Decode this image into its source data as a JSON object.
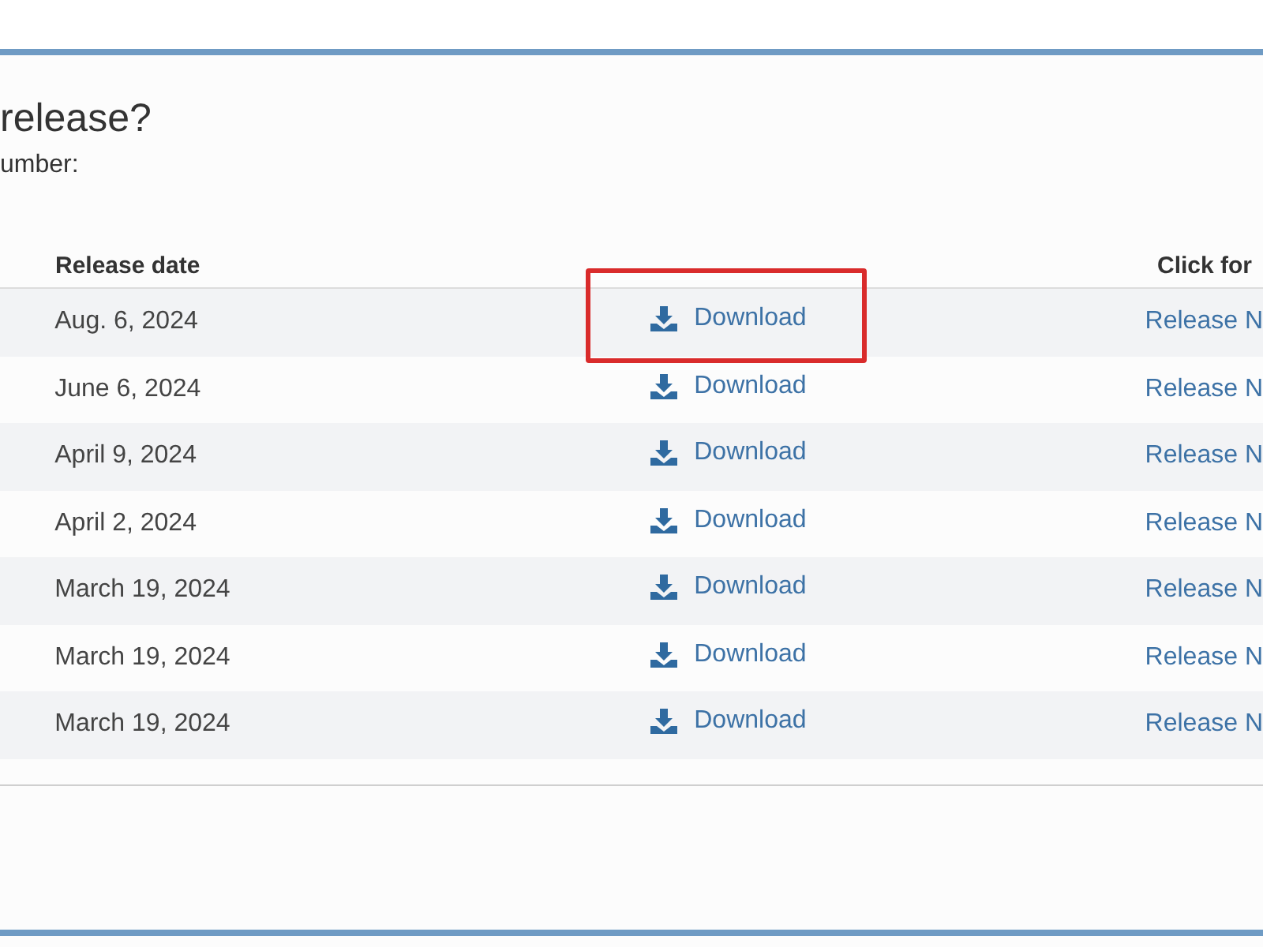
{
  "heading": "release?",
  "prompt": "umber:",
  "table": {
    "columns": [
      "Release date",
      "",
      "Click for"
    ],
    "rows": [
      {
        "date": "Aug. 6, 2024",
        "download": "Download",
        "notes": "Release N",
        "highlighted": true
      },
      {
        "date": "June 6, 2024",
        "download": "Download",
        "notes": "Release N",
        "highlighted": false
      },
      {
        "date": "April 9, 2024",
        "download": "Download",
        "notes": "Release N",
        "highlighted": false
      },
      {
        "date": "April 2, 2024",
        "download": "Download",
        "notes": "Release N",
        "highlighted": false
      },
      {
        "date": "March 19, 2024",
        "download": "Download",
        "notes": "Release N",
        "highlighted": false
      },
      {
        "date": "March 19, 2024",
        "download": "Download",
        "notes": "Release N",
        "highlighted": false
      },
      {
        "date": "March 19, 2024",
        "download": "Download",
        "notes": "Release N",
        "highlighted": false
      }
    ]
  }
}
